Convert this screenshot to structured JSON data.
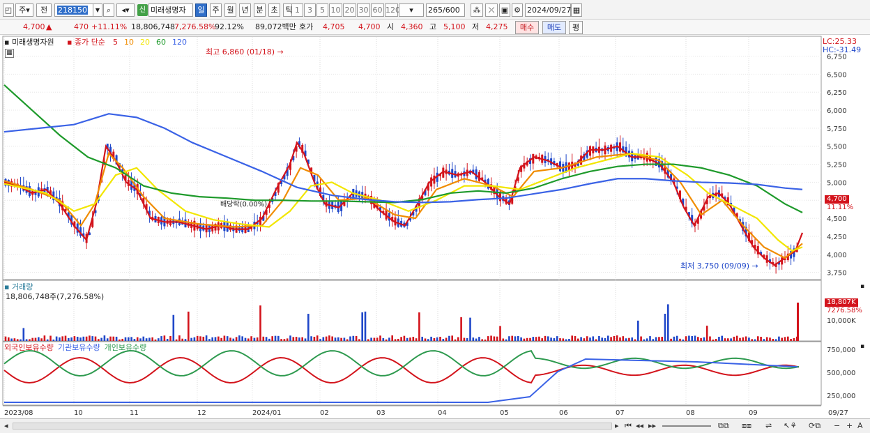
{
  "toolbar": {
    "period_left": "주",
    "prev_label": "전",
    "stock_code": "218150",
    "dropdown_arrow": "▼",
    "search_icon": "magnifier-icon",
    "sound_icon": "speaker-icon",
    "market_badge": "신",
    "stock_name": "미래생명자",
    "periods": [
      "일",
      "주",
      "월",
      "년",
      "분",
      "초",
      "틱"
    ],
    "selected_period": "일",
    "intervals": [
      "1",
      "3",
      "5",
      "10",
      "20",
      "30",
      "60",
      "120"
    ],
    "count_value": "265",
    "count_total": "/600",
    "date_value": "2024/09/27"
  },
  "quote": {
    "price": "4,700",
    "change_arrow": "▲",
    "change": "470",
    "change_pct": "+11.11%",
    "volume": "18,806,748",
    "volume_ratio": "7,276.58%",
    "turnover": "92.12%",
    "amount": "89,072백만",
    "bid_label": "호가",
    "bid": "4,705",
    "ask": "4,700",
    "open_label": "시",
    "open": "4,360",
    "high_label": "고",
    "high": "5,100",
    "low_label": "저",
    "low": "4,275",
    "buy_button": "매수",
    "sell_button": "매도",
    "eval_button": "평"
  },
  "price_panel": {
    "stock_label": "미래생명자원",
    "ma_title": "종가 단순",
    "ma_periods": [
      "5",
      "10",
      "20",
      "60",
      "120"
    ],
    "ma_colors": [
      "#d3141c",
      "#f08c00",
      "#f2e600",
      "#1e9a2b",
      "#3a62e6"
    ],
    "lc_label": "LC:25.33",
    "hc_label": "HC:-31.49",
    "high_note": "최고 6,860 (01/18)",
    "low_note": "최저 3,750 (09/09)",
    "dividend_note": "배당락(0.00%)",
    "current_price_box": "4,700",
    "current_pct_box": "11.11%",
    "y_ticks": [
      "6,750",
      "6,500",
      "6,250",
      "6,000",
      "5,750",
      "5,500",
      "5,250",
      "5,000",
      "4,750",
      "4,500",
      "4,250",
      "4,000",
      "3,750"
    ]
  },
  "volume_panel": {
    "title": "거래량",
    "value_line": "18,806,748주(7,276.58%)",
    "box_value": "18,807K",
    "box_pct": "7276.58%",
    "y_tick": "10,000K"
  },
  "holdings_panel": {
    "legend": [
      "외국인보유수량",
      "기관보유수량",
      "개인보유수량"
    ],
    "colors": [
      "#d3141c",
      "#3a62e6",
      "#2e9a4f"
    ],
    "y_ticks": [
      "750,000",
      "500,000",
      "250,000"
    ]
  },
  "x_axis": {
    "labels": [
      "2023/08",
      "10",
      "11",
      "12",
      "2024/01",
      "02",
      "03",
      "04",
      "05",
      "06",
      "07",
      "08",
      "09",
      "09/27"
    ]
  },
  "chart_data": {
    "type": "line",
    "title": "",
    "ylim": [
      3650,
      6900
    ],
    "series": [
      {
        "name": "5",
        "points": [
          [
            0,
            5000
          ],
          [
            20,
            4950
          ],
          [
            40,
            4850
          ],
          [
            60,
            4900
          ],
          [
            80,
            4700
          ],
          [
            100,
            4400
          ],
          [
            118,
            4200
          ],
          [
            132,
            4700
          ],
          [
            146,
            5500
          ],
          [
            160,
            5300
          ],
          [
            175,
            5000
          ],
          [
            190,
            4900
          ],
          [
            210,
            4500
          ],
          [
            230,
            4450
          ],
          [
            250,
            4450
          ],
          [
            270,
            4400
          ],
          [
            290,
            4350
          ],
          [
            310,
            4400
          ],
          [
            330,
            4350
          ],
          [
            350,
            4350
          ],
          [
            370,
            4500
          ],
          [
            390,
            4900
          ],
          [
            410,
            5250
          ],
          [
            420,
            5550
          ],
          [
            430,
            5400
          ],
          [
            445,
            5000
          ],
          [
            460,
            4700
          ],
          [
            480,
            4650
          ],
          [
            500,
            4850
          ],
          [
            520,
            4800
          ],
          [
            540,
            4600
          ],
          [
            560,
            4450
          ],
          [
            575,
            4400
          ],
          [
            590,
            4650
          ],
          [
            610,
            5000
          ],
          [
            630,
            5150
          ],
          [
            650,
            5100
          ],
          [
            670,
            5150
          ],
          [
            690,
            5000
          ],
          [
            710,
            4800
          ],
          [
            725,
            4700
          ],
          [
            740,
            5200
          ],
          [
            760,
            5350
          ],
          [
            780,
            5300
          ],
          [
            800,
            5200
          ],
          [
            820,
            5250
          ],
          [
            840,
            5450
          ],
          [
            860,
            5450
          ],
          [
            880,
            5500
          ],
          [
            900,
            5350
          ],
          [
            920,
            5350
          ],
          [
            940,
            5250
          ],
          [
            960,
            5000
          ],
          [
            975,
            4650
          ],
          [
            990,
            4400
          ],
          [
            1010,
            4800
          ],
          [
            1025,
            4850
          ],
          [
            1040,
            4700
          ],
          [
            1060,
            4350
          ],
          [
            1075,
            4100
          ],
          [
            1090,
            3950
          ],
          [
            1105,
            3850
          ],
          [
            1120,
            3950
          ],
          [
            1135,
            4050
          ],
          [
            1145,
            4300
          ]
        ]
      },
      {
        "name": "10",
        "points": [
          [
            0,
            5020
          ],
          [
            40,
            4900
          ],
          [
            80,
            4750
          ],
          [
            110,
            4400
          ],
          [
            130,
            4700
          ],
          [
            150,
            5400
          ],
          [
            170,
            5200
          ],
          [
            200,
            4800
          ],
          [
            230,
            4500
          ],
          [
            280,
            4420
          ],
          [
            330,
            4380
          ],
          [
            370,
            4400
          ],
          [
            400,
            4750
          ],
          [
            425,
            5200
          ],
          [
            450,
            5100
          ],
          [
            480,
            4750
          ],
          [
            520,
            4780
          ],
          [
            560,
            4550
          ],
          [
            590,
            4500
          ],
          [
            620,
            4900
          ],
          [
            660,
            5050
          ],
          [
            700,
            4950
          ],
          [
            730,
            4800
          ],
          [
            760,
            5150
          ],
          [
            800,
            5200
          ],
          [
            850,
            5350
          ],
          [
            900,
            5400
          ],
          [
            940,
            5300
          ],
          [
            970,
            5000
          ],
          [
            1000,
            4550
          ],
          [
            1030,
            4750
          ],
          [
            1060,
            4400
          ],
          [
            1090,
            4100
          ],
          [
            1120,
            3950
          ],
          [
            1145,
            4150
          ]
        ]
      },
      {
        "name": "20",
        "points": [
          [
            0,
            4980
          ],
          [
            60,
            4850
          ],
          [
            100,
            4600
          ],
          [
            130,
            4700
          ],
          [
            160,
            5100
          ],
          [
            190,
            5200
          ],
          [
            220,
            4900
          ],
          [
            260,
            4600
          ],
          [
            300,
            4480
          ],
          [
            340,
            4420
          ],
          [
            380,
            4380
          ],
          [
            410,
            4600
          ],
          [
            440,
            4950
          ],
          [
            470,
            5000
          ],
          [
            500,
            4850
          ],
          [
            540,
            4750
          ],
          [
            580,
            4600
          ],
          [
            620,
            4750
          ],
          [
            660,
            4950
          ],
          [
            700,
            4950
          ],
          [
            740,
            4900
          ],
          [
            780,
            5050
          ],
          [
            820,
            5200
          ],
          [
            860,
            5300
          ],
          [
            900,
            5400
          ],
          [
            940,
            5350
          ],
          [
            980,
            5100
          ],
          [
            1010,
            4850
          ],
          [
            1040,
            4700
          ],
          [
            1080,
            4500
          ],
          [
            1110,
            4200
          ],
          [
            1130,
            4050
          ],
          [
            1145,
            4100
          ]
        ]
      },
      {
        "name": "60",
        "points": [
          [
            0,
            6350
          ],
          [
            40,
            6000
          ],
          [
            80,
            5650
          ],
          [
            120,
            5350
          ],
          [
            160,
            5200
          ],
          [
            200,
            4950
          ],
          [
            240,
            4850
          ],
          [
            280,
            4800
          ],
          [
            320,
            4780
          ],
          [
            360,
            4750
          ],
          [
            400,
            4750
          ],
          [
            440,
            4740
          ],
          [
            480,
            4740
          ],
          [
            520,
            4730
          ],
          [
            560,
            4720
          ],
          [
            600,
            4760
          ],
          [
            640,
            4850
          ],
          [
            680,
            4880
          ],
          [
            720,
            4850
          ],
          [
            760,
            4920
          ],
          [
            800,
            5050
          ],
          [
            840,
            5150
          ],
          [
            880,
            5220
          ],
          [
            920,
            5250
          ],
          [
            960,
            5250
          ],
          [
            1000,
            5200
          ],
          [
            1040,
            5100
          ],
          [
            1080,
            4950
          ],
          [
            1120,
            4700
          ],
          [
            1145,
            4580
          ]
        ]
      },
      {
        "name": "120",
        "points": [
          [
            0,
            5700
          ],
          [
            60,
            5760
          ],
          [
            100,
            5800
          ],
          [
            150,
            5950
          ],
          [
            190,
            5900
          ],
          [
            230,
            5750
          ],
          [
            270,
            5550
          ],
          [
            320,
            5350
          ],
          [
            370,
            5150
          ],
          [
            420,
            4930
          ],
          [
            470,
            4820
          ],
          [
            520,
            4760
          ],
          [
            560,
            4730
          ],
          [
            600,
            4720
          ],
          [
            640,
            4730
          ],
          [
            680,
            4760
          ],
          [
            720,
            4780
          ],
          [
            760,
            4840
          ],
          [
            800,
            4900
          ],
          [
            840,
            4980
          ],
          [
            880,
            5050
          ],
          [
            920,
            5050
          ],
          [
            960,
            5020
          ],
          [
            1000,
            5000
          ],
          [
            1040,
            4990
          ],
          [
            1080,
            4970
          ],
          [
            1120,
            4920
          ],
          [
            1145,
            4900
          ]
        ]
      }
    ]
  }
}
